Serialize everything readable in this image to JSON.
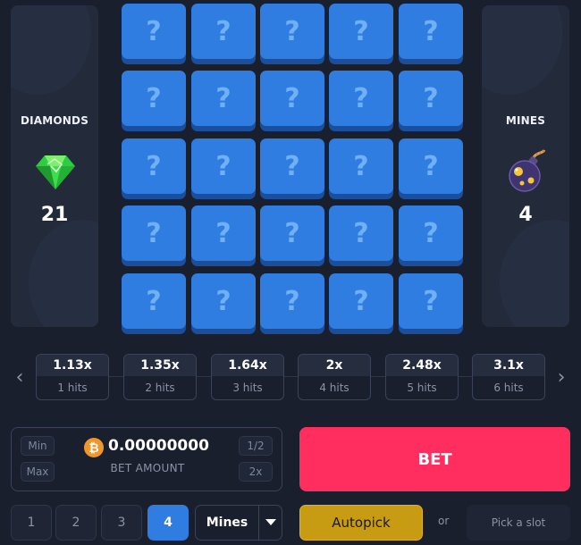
{
  "diamonds_panel": {
    "title": "DIAMONDS",
    "count": "21",
    "icon": "diamond-icon",
    "color": "#2ecc40"
  },
  "mines_panel": {
    "title": "MINES",
    "count": "4",
    "icon": "bomb-icon"
  },
  "tiles": {
    "symbol": "?",
    "rows": 5,
    "cols": 5,
    "color": "#2f7de0"
  },
  "payouts": [
    {
      "multiplier": "1.13x",
      "label": "1 hits"
    },
    {
      "multiplier": "1.35x",
      "label": "2 hits"
    },
    {
      "multiplier": "1.64x",
      "label": "3 hits"
    },
    {
      "multiplier": "2x",
      "label": "4 hits"
    },
    {
      "multiplier": "2.48x",
      "label": "5 hits"
    },
    {
      "multiplier": "3.1x",
      "label": "6 hits"
    }
  ],
  "nav": {
    "prev": "‹",
    "next": "›"
  },
  "bet": {
    "min_label": "Min",
    "max_label": "Max",
    "half_label": "1/2",
    "double_label": "2x",
    "amount": "0.00000000",
    "amount_label": "BET AMOUNT",
    "currency_icon": "bitcoin-icon",
    "currency_symbol": "₿",
    "button_label": "BET",
    "button_color": "#ff2e5f"
  },
  "mine_count": {
    "options": [
      "1",
      "2",
      "3",
      "4"
    ],
    "selected": "4",
    "select_label": "Mines"
  },
  "autopick": {
    "label": "Autopick",
    "or_text": "or",
    "pick_slot_label": "Pick a slot",
    "color": "#c79b12"
  }
}
